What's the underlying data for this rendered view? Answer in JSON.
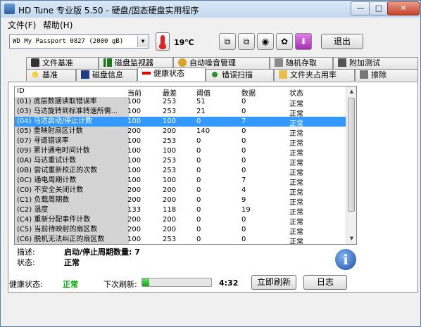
{
  "window": {
    "title": "HD Tune 专业版 5.50 - 硬盘/固态硬盘实用程序",
    "min": "—",
    "max": "□",
    "close": "✕"
  },
  "menu": [
    "文件(F)",
    "帮助(H)"
  ],
  "toolbar": {
    "drive": "WD      My Passport 0827 (2000 gB)",
    "temperature": "19℃",
    "exit": "退出"
  },
  "tabs_row1": [
    "文件基准",
    "磁盘监视器",
    "自动噪音管理",
    "随机存取",
    "附加测试"
  ],
  "tabs_row2": [
    "基准",
    "磁盘信息",
    "健康状态",
    "错误扫描",
    "文件夹占用率",
    "擦除"
  ],
  "active_tab": "健康状态",
  "table": {
    "headers": [
      "ID",
      "当前",
      "最差",
      "阈值",
      "数据",
      "状态"
    ],
    "rows": [
      [
        "(01) 底层数据读取错误率",
        "100",
        "253",
        "51",
        "0",
        "正常"
      ],
      [
        "(03) 马达旋转到标准转速所需...",
        "100",
        "253",
        "21",
        "0",
        "正常"
      ],
      [
        "(04) 马达启动/停止计数",
        "100",
        "100",
        "0",
        "7",
        "正常"
      ],
      [
        "(05) 重映射扇区计数",
        "200",
        "200",
        "140",
        "0",
        "正常"
      ],
      [
        "(07) 寻道错误率",
        "100",
        "253",
        "0",
        "0",
        "正常"
      ],
      [
        "(09) 累计通电时间计数",
        "100",
        "100",
        "0",
        "0",
        "正常"
      ],
      [
        "(0A) 马达重试计数",
        "100",
        "253",
        "0",
        "0",
        "正常"
      ],
      [
        "(0B) 尝试重新校正的次数",
        "100",
        "253",
        "0",
        "0",
        "正常"
      ],
      [
        "(0C) 通电周期计数",
        "100",
        "100",
        "0",
        "7",
        "正常"
      ],
      [
        "(C0) 不安全关闭计数",
        "200",
        "200",
        "0",
        "4",
        "正常"
      ],
      [
        "(C1) 负载周期数",
        "200",
        "200",
        "0",
        "9",
        "正常"
      ],
      [
        "(C2) 温度",
        "133",
        "118",
        "0",
        "19",
        "正常"
      ],
      [
        "(C4) 重新分配事件计数",
        "200",
        "200",
        "0",
        "0",
        "正常"
      ],
      [
        "(C5) 当前待映射的扇区数",
        "200",
        "200",
        "0",
        "0",
        "正常"
      ],
      [
        "(C6) 脱机无法纠正的扇区数",
        "100",
        "253",
        "0",
        "0",
        "正常"
      ]
    ],
    "selected_row": 2
  },
  "detail": {
    "desc_label": "描述:",
    "desc_value": "启动/停止周期数量: 7",
    "status_label": "状态:",
    "status_value": "正常"
  },
  "bottom": {
    "health_label": "健康状态:",
    "health_value": "正常",
    "refresh_label": "下次刷新:",
    "refresh_progress": 0.1,
    "refresh_time": "4:32",
    "refresh_now": "立即刷新",
    "log": "日志"
  },
  "colors": {
    "selection": "#3399ff",
    "health_ok": "#00aa00"
  }
}
